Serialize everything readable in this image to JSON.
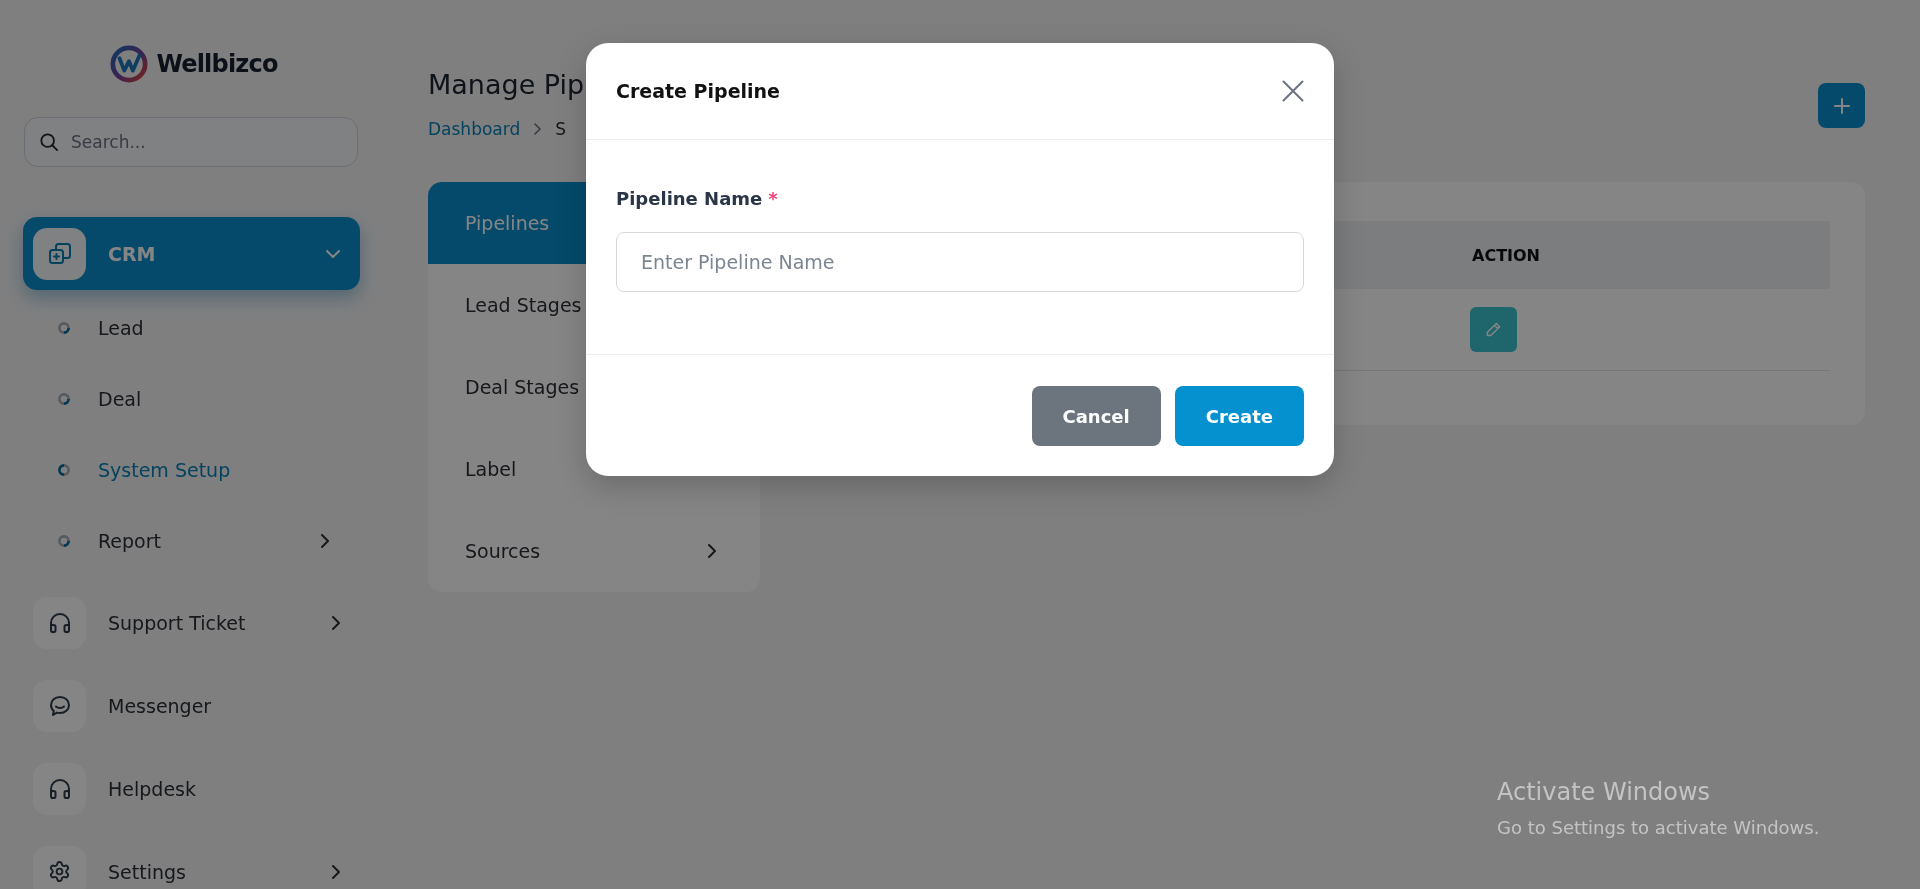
{
  "sidebar": {
    "logo": {
      "text": "Wellbizco"
    },
    "search": {
      "placeholder": "Search..."
    },
    "menu": [
      {
        "label": "CRM",
        "selected": true,
        "expanded": true,
        "children": [
          {
            "label": "Lead",
            "selected": false
          },
          {
            "label": "Deal",
            "selected": false
          },
          {
            "label": "System Setup",
            "selected": true
          },
          {
            "label": "Report",
            "selected": false,
            "expanded": false
          }
        ]
      },
      {
        "label": "Support Ticket",
        "selected": false,
        "expanded": false
      },
      {
        "label": "Messenger",
        "selected": false
      },
      {
        "label": "Helpdesk",
        "selected": false
      },
      {
        "label": "Settings",
        "selected": false,
        "expanded": false
      }
    ]
  },
  "page": {
    "title": "Manage Pip",
    "breadcrumb": [
      {
        "label": "Dashboard",
        "kind": "link"
      },
      {
        "label": "S",
        "kind": "current"
      }
    ]
  },
  "settings_tabs": [
    {
      "label": "Pipelines",
      "selected": true
    },
    {
      "label": "Lead Stages",
      "selected": false
    },
    {
      "label": "Deal Stages",
      "selected": false
    },
    {
      "label": "Label",
      "selected": false
    },
    {
      "label": "Sources",
      "selected": false,
      "expanded": false
    }
  ],
  "table": {
    "columns": [
      "ACTION"
    ],
    "rows": [
      {
        "actions": [
          {
            "kind": "edit"
          }
        ]
      }
    ]
  },
  "modal": {
    "title": "Create Pipeline",
    "fields": [
      {
        "label": "Pipeline Name",
        "required_mark": "*",
        "placeholder": "Enter Pipeline Name"
      }
    ],
    "buttons": [
      {
        "label": "Cancel",
        "kind": "secondary"
      },
      {
        "label": "Create",
        "kind": "primary"
      }
    ]
  },
  "os_notice": {
    "title": "Activate Windows",
    "text": "Go to Settings to activate Windows."
  }
}
